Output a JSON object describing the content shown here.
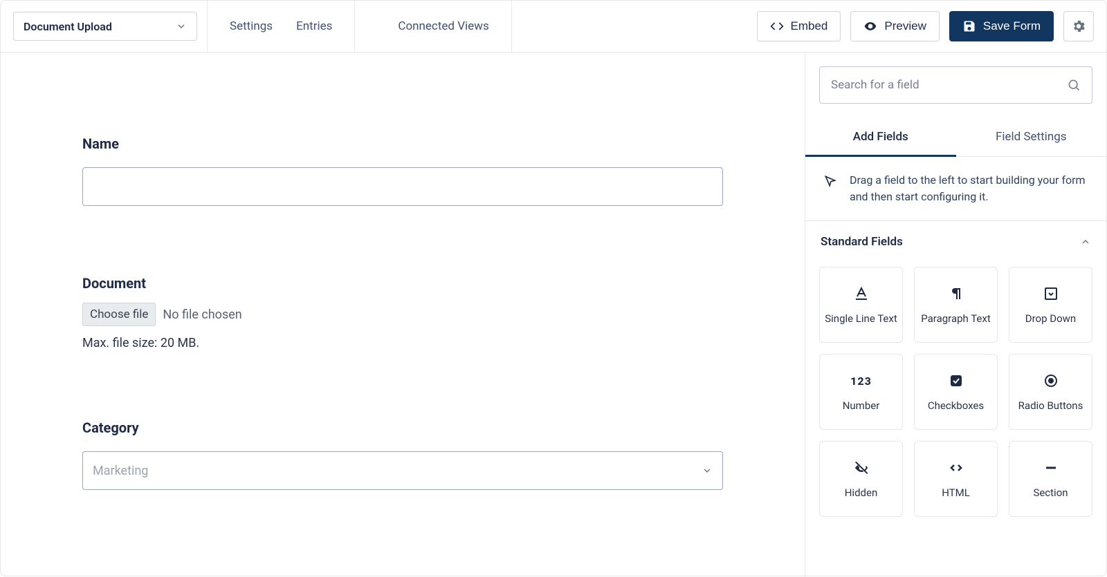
{
  "header": {
    "form_selector": "Document Upload",
    "nav": {
      "settings": "Settings",
      "entries": "Entries",
      "connected_views": "Connected Views"
    },
    "embed": "Embed",
    "preview": "Preview",
    "save": "Save Form"
  },
  "canvas": {
    "name_label": "Name",
    "document_label": "Document",
    "choose_file": "Choose file",
    "no_file": "No file chosen",
    "file_hint": "Max. file size: 20 MB.",
    "category_label": "Category",
    "category_value": "Marketing"
  },
  "sidebar": {
    "search_placeholder": "Search for a field",
    "tabs": {
      "add_fields": "Add Fields",
      "field_settings": "Field Settings"
    },
    "hint": "Drag a field to the left to start building your form and then start configuring it.",
    "standard_fields_title": "Standard Fields",
    "fields": {
      "single_line_text": "Single Line Text",
      "paragraph_text": "Paragraph Text",
      "drop_down": "Drop Down",
      "number": "Number",
      "checkboxes": "Checkboxes",
      "radio_buttons": "Radio Buttons",
      "hidden": "Hidden",
      "html": "HTML",
      "section": "Section"
    }
  }
}
